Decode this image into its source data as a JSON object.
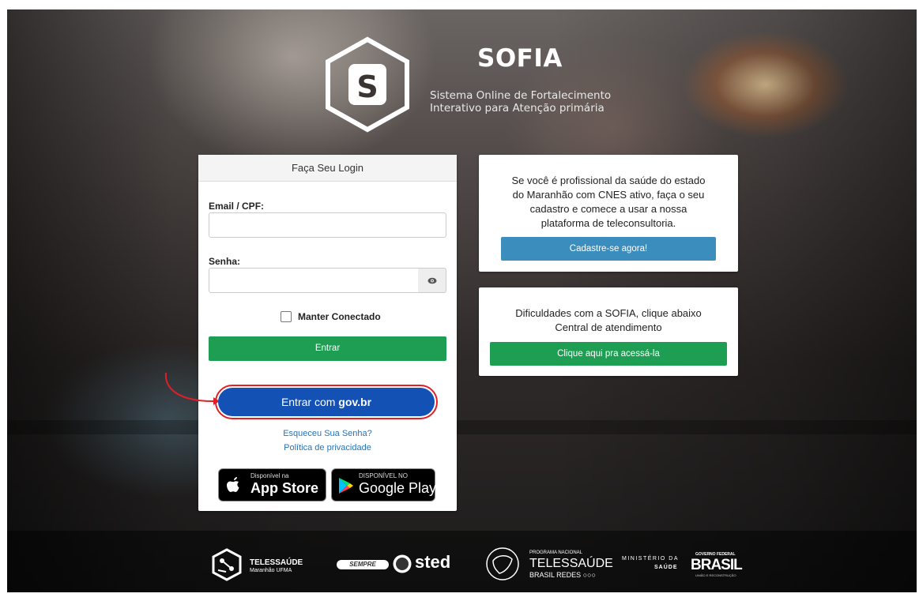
{
  "brand": {
    "logo_letter": "S",
    "title": "SOFIA",
    "subtitle_line1": "Sistema Online de Fortalecimento",
    "subtitle_line2": "Interativo para Atenção primária"
  },
  "login": {
    "header": "Faça Seu Login",
    "email_label": "Email / CPF:",
    "email_value": "",
    "password_label": "Senha:",
    "password_value": "",
    "keep_connected": "Manter Conectado",
    "keep_connected_checked": false,
    "enter_button": "Entrar",
    "gov_prefix": "Entrar com ",
    "gov_suffix": "gov.br",
    "forgot_password": "Esqueceu Sua Senha?",
    "privacy_policy": "Política de privacidade"
  },
  "stores": {
    "apple_small": "Disponível na",
    "apple_big": "App Store",
    "google_small": "DISPONÍVEL NO",
    "google_big": "Google Play"
  },
  "register_card": {
    "line1": "Se você é profissional da saúde do estado",
    "line2": "do Maranhão com CNES ativo, faça o seu",
    "line3": "cadastro e comece a usar a nossa",
    "line4": "plataforma de teleconsultoria.",
    "button": "Cadastre-se agora!"
  },
  "help_card": {
    "line1": "Dificuldades com a SOFIA, clique abaixo",
    "line2": "Central de atendimento",
    "button": "Clique aqui pra acessá-la"
  },
  "footer": {
    "telessaude_title": "TELESSAÚDE",
    "telessaude_sub": "Maranhão UFMA",
    "sempre_text": "SEMPRE",
    "sted_text": "sted",
    "programa_small": "PROGRAMA NACIONAL",
    "programa_title": "TELESSAÚDE",
    "programa_sub": "BRASIL REDES",
    "ministerio_line1": "MINISTÉRIO DA",
    "ministerio_line2": "SAÚDE",
    "governo_small": "GOVERNO FEDERAL",
    "governo_title": "BRASIL",
    "governo_sub": "UNIÃO E RECONSTRUÇÃO"
  },
  "colors": {
    "green": "#1e9e52",
    "blue": "#3a8dbd",
    "govbr": "#1451b4",
    "highlight": "#e01f26"
  }
}
